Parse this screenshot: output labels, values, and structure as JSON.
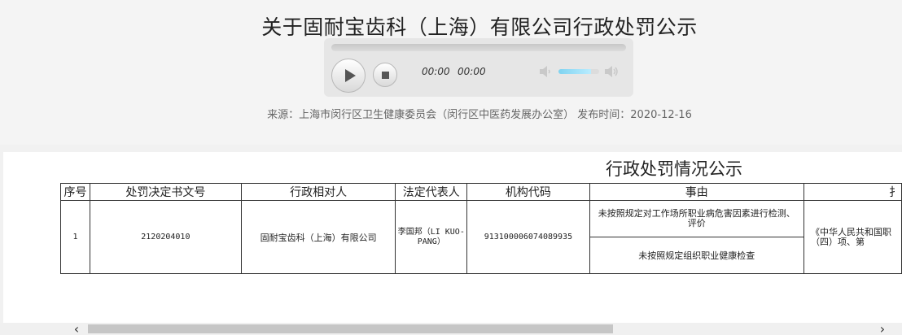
{
  "page": {
    "title": "关于固耐宝齿科（上海）有限公司行政处罚公示",
    "source_line": "来源：上海市闵行区卫生健康委员会（闵行区中医药发展办公室） 发布时间：2020-12-16"
  },
  "player": {
    "current_time": "00:00",
    "duration": "00:00",
    "volume_level": 0.8
  },
  "notice": {
    "title": "行政处罚情况公示"
  },
  "table": {
    "headers": [
      "序号",
      "处罚决定书文号",
      "行政相对人",
      "法定代表人",
      "机构代码",
      "事由",
      "扌"
    ],
    "rows": [
      {
        "index": "1",
        "decision_no": "2120204010",
        "party": "固耐宝齿科（上海）有限公司",
        "legal_rep": "李国邦（LI KUO-PANG）",
        "org_code": "913100006074089935",
        "reason_1": "未按照规定对工作场所职业病危害因素进行检测、评价",
        "reason_2": "未按照规定组织职业健康检查",
        "basis_clipped": "《中华人民共和国职（四）项、第"
      }
    ]
  },
  "scroll": {
    "left_arrow": "‹",
    "right_arrow": "›"
  }
}
